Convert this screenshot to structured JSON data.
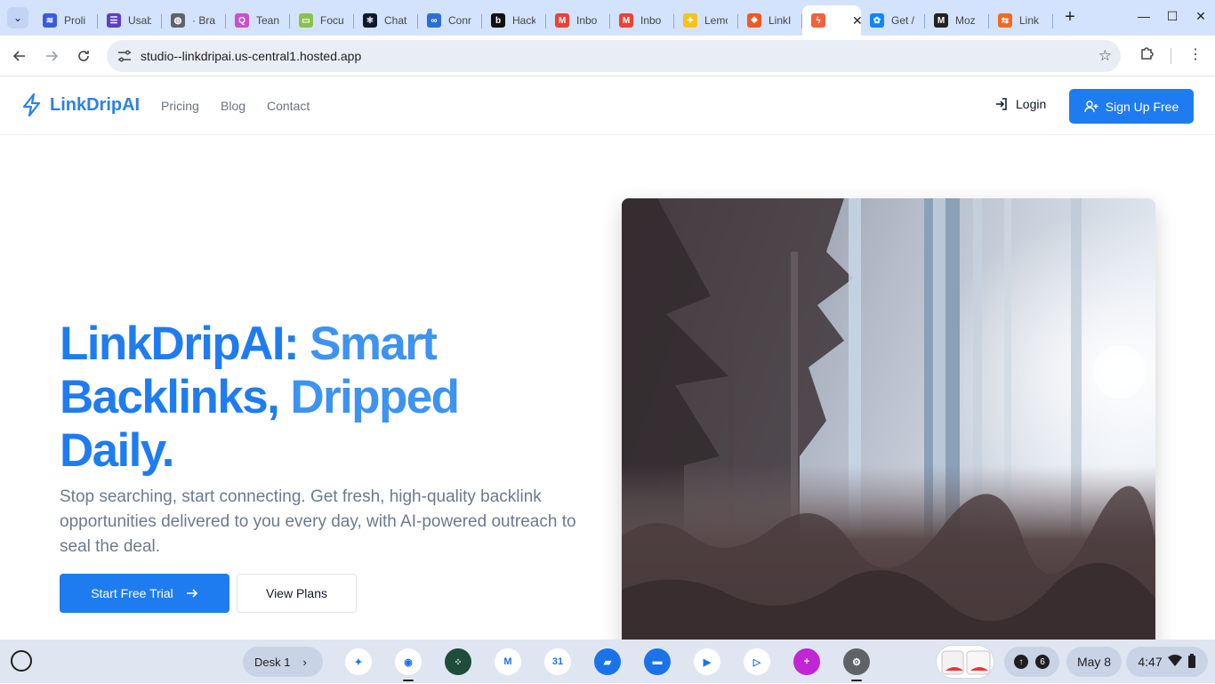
{
  "browser": {
    "tabs": [
      {
        "title": "Proli",
        "icon": "proli-favicon-icon",
        "color": "#3b5bdb",
        "glyph": "≋"
      },
      {
        "title": "Usab",
        "icon": "usab-favicon-icon",
        "color": "#5b3fc4",
        "glyph": "☰"
      },
      {
        "title": "· Bra",
        "icon": "globe-favicon-icon",
        "color": "#5f6368",
        "glyph": "◍"
      },
      {
        "title": "Tean",
        "icon": "team-favicon-icon",
        "color": "#c94fd1",
        "glyph": "Q"
      },
      {
        "title": "Focu",
        "icon": "focus-favicon-icon",
        "color": "#8bc34a",
        "glyph": "▭"
      },
      {
        "title": "Chat",
        "icon": "chat-favicon-icon",
        "color": "#0e1a2b",
        "glyph": "⚛"
      },
      {
        "title": "Conr",
        "icon": "link-favicon-icon",
        "color": "#2b6fd6",
        "glyph": "∞"
      },
      {
        "title": "Hack",
        "icon": "hack-favicon-icon",
        "color": "#111111",
        "glyph": "b"
      },
      {
        "title": "Inbo",
        "icon": "gmail-favicon-icon",
        "color": "#ea4335",
        "glyph": "M"
      },
      {
        "title": "Inbo",
        "icon": "gmail-favicon-icon",
        "color": "#ea4335",
        "glyph": "M"
      },
      {
        "title": "Lemo",
        "icon": "lemon-favicon-icon",
        "color": "#f6c21c",
        "glyph": "✦"
      },
      {
        "title": "LinkI",
        "icon": "linki-favicon-icon",
        "color": "#f05a22",
        "glyph": "❖"
      },
      {
        "title": "",
        "icon": "linkdrip-favicon-icon",
        "color": "#f0623d",
        "glyph": "ϟ",
        "active": true
      },
      {
        "title": "Get /",
        "icon": "bluesky-favicon-icon",
        "color": "#1185fe",
        "glyph": "✿"
      },
      {
        "title": "Moz",
        "icon": "moz-favicon-icon",
        "color": "#222222",
        "glyph": "M"
      },
      {
        "title": "Link",
        "icon": "link-orange-favicon-icon",
        "color": "#f26a21",
        "glyph": "⇆"
      }
    ],
    "new_tab_label": "+",
    "url": "studio--linkdripai.us-central1.hosted.app"
  },
  "site": {
    "brand_name": "LinkDripAI",
    "nav": [
      "Pricing",
      "Blog",
      "Contact"
    ],
    "login_label": "Login",
    "signup_label": "Sign Up Free",
    "hero": {
      "title_part1": "LinkDripAI: Smart",
      "title_part2": "Backlinks, Dripped",
      "title_part3": "Daily.",
      "subtitle": "Stop searching, start connecting. Get fresh, high-quality backlink opportunities delivered to you every day, with AI-powered outreach to seal the deal.",
      "cta_primary": "Start Free Trial",
      "cta_secondary": "View Plans"
    },
    "colors": {
      "accent": "#1f7cf0"
    }
  },
  "shelf": {
    "desk_label": "Desk 1",
    "apps": [
      {
        "name": "gemini-app-icon",
        "color": "#ffffff"
      },
      {
        "name": "chrome-app-icon",
        "color": "#ffffff"
      },
      {
        "name": "elements-app-icon",
        "color": "#1e4d3a"
      },
      {
        "name": "gmail-app-icon",
        "color": "#ffffff"
      },
      {
        "name": "calendar-app-icon",
        "color": "#ffffff"
      },
      {
        "name": "files-app-icon",
        "color": "#1a73e8"
      },
      {
        "name": "messages-app-icon",
        "color": "#1a73e8"
      },
      {
        "name": "meet-app-icon",
        "color": "#ffffff"
      },
      {
        "name": "play-store-app-icon",
        "color": "#ffffff"
      },
      {
        "name": "screencast-app-icon",
        "color": "#c026d3"
      },
      {
        "name": "settings-app-icon",
        "color": "#5f6368"
      }
    ],
    "notification_count": "6",
    "date": "May 8",
    "time": "4:47"
  }
}
